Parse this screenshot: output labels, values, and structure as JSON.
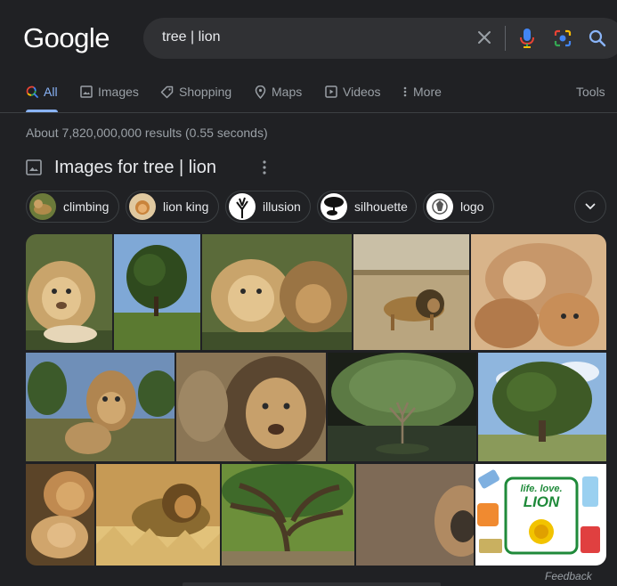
{
  "logo": {
    "text": "Google"
  },
  "search": {
    "query": "tree | lion"
  },
  "tabs": [
    {
      "label": "All",
      "icon": "search-colored-icon",
      "active": true
    },
    {
      "label": "Images",
      "icon": "image-icon"
    },
    {
      "label": "Shopping",
      "icon": "tag-icon"
    },
    {
      "label": "Maps",
      "icon": "map-pin-icon"
    },
    {
      "label": "Videos",
      "icon": "play-icon"
    },
    {
      "label": "More",
      "icon": "more-vert-icon"
    }
  ],
  "tools_label": "Tools",
  "result_stats": "About 7,820,000,000 results (0.55 seconds)",
  "images_section": {
    "title": "Images for tree | lion",
    "chips": [
      "climbing",
      "lion king",
      "illusion",
      "silhouette",
      "logo"
    ],
    "images": [
      {
        "alt": "lion cubs",
        "palette": [
          "#8a6a3c",
          "#c9a46b",
          "#3f4f2a"
        ]
      },
      {
        "alt": "tree in field",
        "palette": [
          "#7fa8d6",
          "#2f4a1e",
          "#5b7a31"
        ]
      },
      {
        "alt": "lion cubs",
        "palette": [
          "#8a6a3c",
          "#c9a46b",
          "#3f4f2a"
        ]
      },
      {
        "alt": "lion on savanna",
        "palette": [
          "#b9a57f",
          "#8d7a55",
          "#4a3a22"
        ]
      },
      {
        "alt": "lioness with cubs",
        "palette": [
          "#c7976a",
          "#e3c29a",
          "#9b6a43"
        ]
      },
      {
        "alt": "lioness",
        "palette": [
          "#6f8fb8",
          "#b08550",
          "#6b6b3f"
        ]
      },
      {
        "alt": "male lion face",
        "palette": [
          "#8a7555",
          "#c7a06b",
          "#5a4630"
        ]
      },
      {
        "alt": "tree illusion",
        "palette": [
          "#2f3a2a",
          "#5c7a44",
          "#1b1f18"
        ]
      },
      {
        "alt": "large tree",
        "palette": [
          "#8fb6de",
          "#3e5a26",
          "#8a9a5a"
        ]
      },
      {
        "alt": "lions resting",
        "palette": [
          "#8a6b45",
          "#d0a56c",
          "#5b4428"
        ]
      },
      {
        "alt": "lion in grass",
        "palette": [
          "#c69a55",
          "#8a6a30",
          "#e2c27a"
        ]
      },
      {
        "alt": "angel oak tree",
        "palette": [
          "#3f6a2a",
          "#6c8f3a",
          "#4a3a25"
        ]
      },
      {
        "alt": "lion blurred",
        "palette": [
          "#6b5a48",
          "#b08a62",
          "#3d342b"
        ]
      },
      {
        "alt": "LION logo",
        "palette": [
          "#ffffff",
          "#1f8a3a",
          "#f2c300"
        ]
      }
    ],
    "logo_text_top": "life. love.",
    "logo_text_main": "LION"
  },
  "feedback_label": "Feedback"
}
